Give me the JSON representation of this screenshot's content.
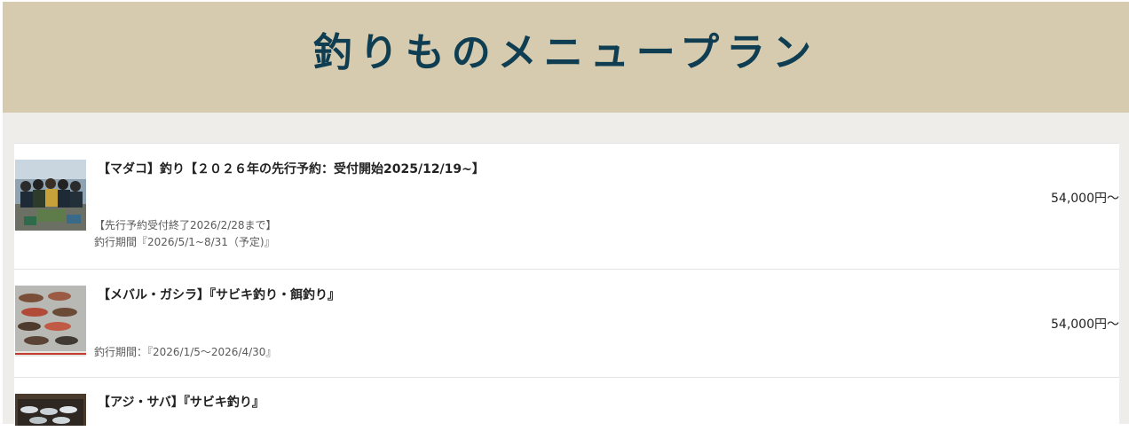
{
  "header": {
    "title": "釣りものメニュープラン",
    "background": "#d6cbae",
    "title_color": "#0f3d52"
  },
  "menu": {
    "items": [
      {
        "title": "【マダコ】釣り【２０２６年の先行予約：受付開始2025/12/19~】",
        "price": "54,000円〜",
        "note_a": "【先行予約受付終了2026/2/28まで】",
        "note_b": "釣行期間『2026/5/1~8/31（予定)』"
      },
      {
        "title": "【メバル・ガシラ】『サビキ釣り・餌釣り』",
        "price": "54,000円〜",
        "note_b": "釣行期間：『2026/1/5〜2026/4/30』"
      },
      {
        "title": "【アジ・サバ】『サビキ釣り』"
      }
    ]
  }
}
